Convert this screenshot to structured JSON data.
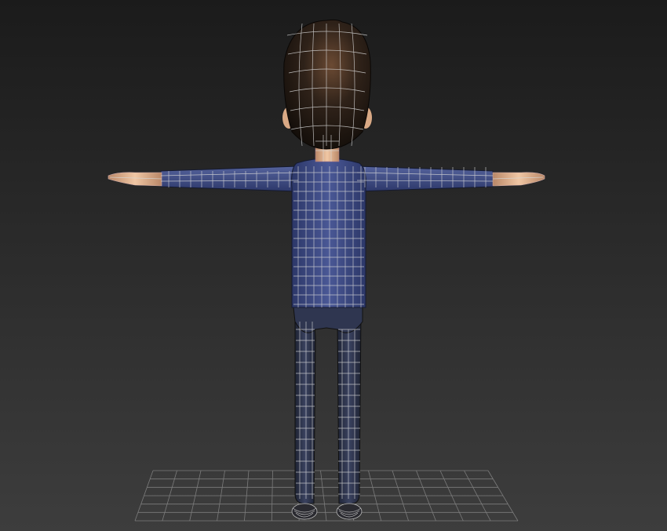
{
  "viewport": {
    "background_top": "#1a1a1a",
    "background_bottom": "#3c3c3c",
    "grid_color": "#8a8a8a",
    "wire_color": "#d9d9d9",
    "shirt_color": "#3f4d87",
    "pants_color": "#303750",
    "skin_color": "#e2b48f",
    "hair_color": "#2a1f17",
    "shoe_color": "#2a2a30"
  },
  "scene_object": {
    "description_key": "character-tpose-model"
  }
}
